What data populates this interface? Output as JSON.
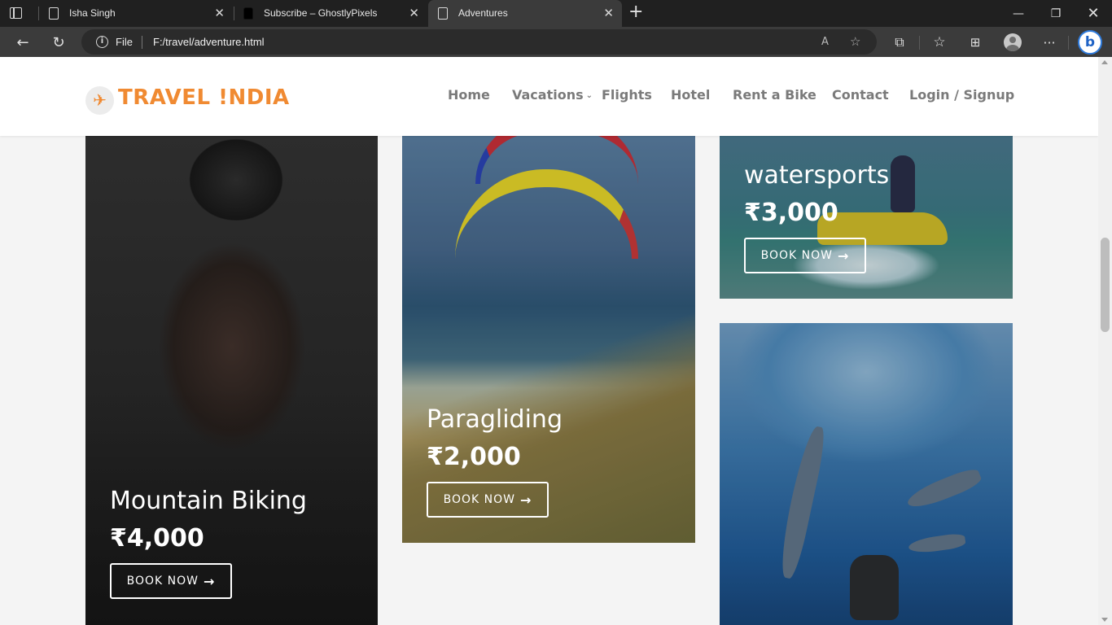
{
  "browser": {
    "tabs": [
      {
        "title": "Isha Singh",
        "active": false
      },
      {
        "title": "Subscribe – GhostlyPixels",
        "active": false
      },
      {
        "title": "Adventures",
        "active": true
      }
    ],
    "address": {
      "scheme_label": "File",
      "url": "F:/travel/adventure.html"
    }
  },
  "site": {
    "logo_text": "TRAVEL !NDIA",
    "brand_color": "#f08a32",
    "menu": [
      "Home",
      "Vacations",
      "Flights",
      "Hotel",
      "Rent a Bike",
      "Contact",
      "Login / Signup"
    ]
  },
  "cards": [
    {
      "title": "Mountain Biking",
      "price": "₹4,000",
      "button": "BOOK NOW"
    },
    {
      "title": "Paragliding",
      "price": "₹2,000",
      "button": "BOOK NOW"
    },
    {
      "title": "watersports",
      "price": "₹3,000",
      "button": "BOOK NOW"
    }
  ]
}
